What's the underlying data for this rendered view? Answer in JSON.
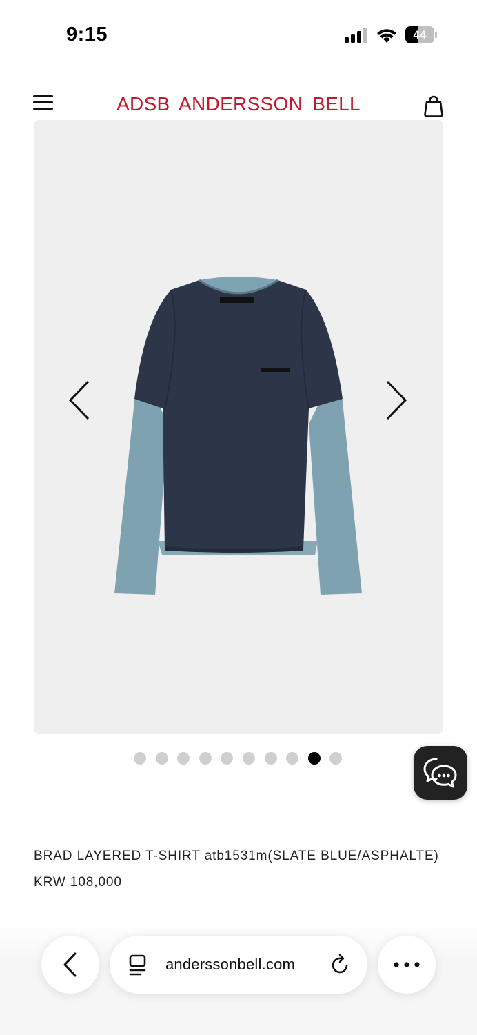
{
  "status_bar": {
    "time": "9:15",
    "battery_level": "44",
    "battery_fraction": 0.44,
    "icons": [
      "cellular-signal-icon",
      "wifi-icon",
      "battery-icon"
    ]
  },
  "header": {
    "brand": "ADSB  ANDERSSON BELL",
    "brand_color": "#c5182f",
    "icons": [
      "hamburger-menu-icon",
      "shopping-bag-icon"
    ]
  },
  "gallery": {
    "image_count": 10,
    "active_index": 8,
    "image_alt": "Layered long-sleeve t-shirt, navy body with slate blue sleeves"
  },
  "product": {
    "name": "BRAD LAYERED T-SHIRT atb1531m(SLATE BLUE/ASPHALTE)",
    "price": "KRW 108,000"
  },
  "browser": {
    "url": "anderssonbell.com",
    "icons": [
      "back-chevron-icon",
      "tabs-icon",
      "reload-icon",
      "more-icon"
    ]
  }
}
